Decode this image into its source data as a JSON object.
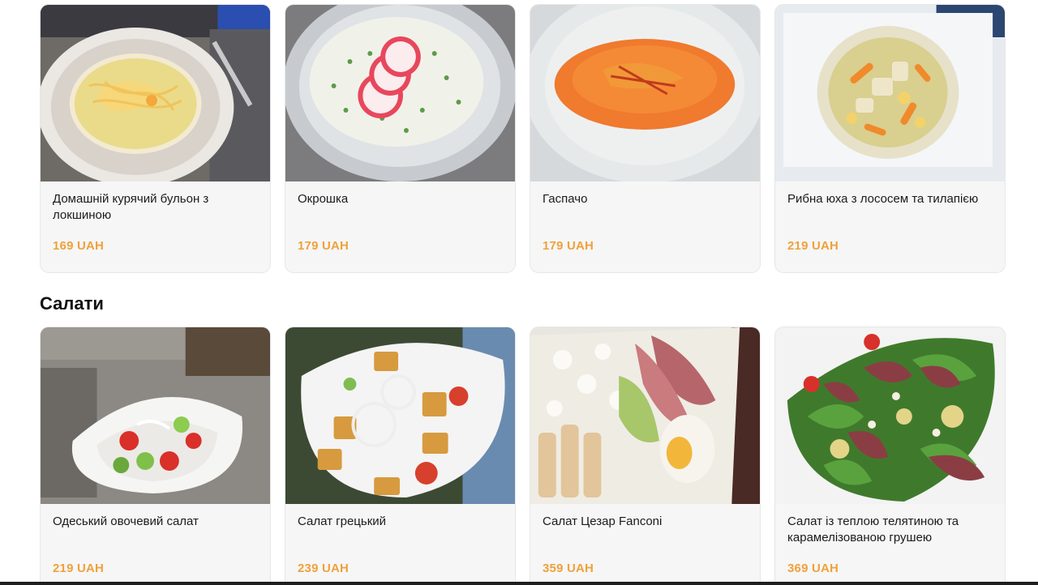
{
  "soups": [
    {
      "name": "Домашній курячий бульон з локшиною",
      "price": "169 UAH",
      "photo": "chicken-noodle-soup-photo"
    },
    {
      "name": "Окрошка",
      "price": "179 UAH",
      "photo": "okroshka-photo"
    },
    {
      "name": "Гаспачо",
      "price": "179 UAH",
      "photo": "gazpacho-photo"
    },
    {
      "name": "Рибна юха з лососем та тилапією",
      "price": "219 UAH",
      "photo": "fish-soup-photo"
    }
  ],
  "salads_section": {
    "title": "Салати"
  },
  "salads": [
    {
      "name": "Одеський овочевий салат",
      "price": "219 UAH",
      "photo": "odesa-vegetable-salad-photo"
    },
    {
      "name": "Салат грецький",
      "price": "239 UAH",
      "photo": "greek-salad-photo"
    },
    {
      "name": "Салат Цезар Fanconi",
      "price": "359 UAH",
      "photo": "caesar-salad-photo"
    },
    {
      "name": "Салат із теплою телятиною та карамелізованою грушею",
      "price": "369 UAH",
      "photo": "veal-pear-salad-photo"
    }
  ],
  "colors": {
    "price": "#f0a13c",
    "card_bg": "#f6f6f6"
  }
}
